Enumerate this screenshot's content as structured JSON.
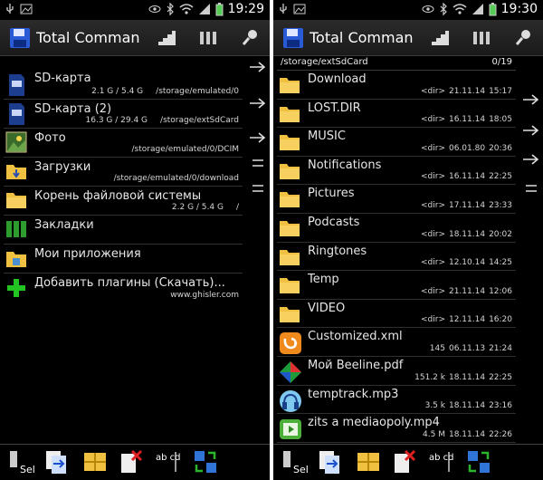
{
  "left": {
    "status": {
      "time": "19:29"
    },
    "app_title": "Total Comman...",
    "rows": [
      {
        "name": "SD-карта",
        "size": "2.1 G / 5.4 G",
        "path": "/storage/emulated/0",
        "icon": "sd-card-icon"
      },
      {
        "name": "SD-карта (2)",
        "size": "16.3 G / 29.4 G",
        "path": "/storage/extSdCard",
        "icon": "sd-card-icon"
      },
      {
        "name": "Фото",
        "size": "",
        "path": "/storage/emulated/0/DCIM",
        "icon": "photo-icon"
      },
      {
        "name": "Загрузки",
        "size": "",
        "path": "/storage/emulated/0/download",
        "icon": "downloads-folder-icon"
      },
      {
        "name": "Корень файловой системы",
        "size": "2.2 G / 5.4 G",
        "path": "/",
        "icon": "folder-icon"
      },
      {
        "name": "Закладки",
        "size": "",
        "path": "",
        "icon": "bookmarks-icon"
      },
      {
        "name": "Мои приложения",
        "size": "",
        "path": "",
        "icon": "apps-folder-icon"
      },
      {
        "name": "Добавить плагины (Скачать)...",
        "size": "",
        "path": "www.ghisler.com",
        "icon": "plus-icon"
      }
    ]
  },
  "right": {
    "status": {
      "time": "19:30"
    },
    "app_title": "Total Comman...",
    "path": "/storage/extSdCard",
    "count": "0/19",
    "rows": [
      {
        "name": "Download",
        "size": "<dir>",
        "date": "21.11.14",
        "time": "15:17",
        "icon": "folder-icon"
      },
      {
        "name": "LOST.DIR",
        "size": "<dir>",
        "date": "16.11.14",
        "time": "18:05",
        "icon": "folder-icon"
      },
      {
        "name": "MUSIC",
        "size": "<dir>",
        "date": "06.01.80",
        "time": "20:36",
        "icon": "folder-icon"
      },
      {
        "name": "Notifications",
        "size": "<dir>",
        "date": "16.11.14",
        "time": "22:25",
        "icon": "folder-icon"
      },
      {
        "name": "Pictures",
        "size": "<dir>",
        "date": "17.11.14",
        "time": "23:33",
        "icon": "folder-icon"
      },
      {
        "name": "Podcasts",
        "size": "<dir>",
        "date": "18.11.14",
        "time": "20:02",
        "icon": "folder-icon"
      },
      {
        "name": "Ringtones",
        "size": "<dir>",
        "date": "12.10.14",
        "time": "14:25",
        "icon": "folder-icon"
      },
      {
        "name": "Temp",
        "size": "<dir>",
        "date": "21.11.14",
        "time": "12:06",
        "icon": "folder-icon"
      },
      {
        "name": "VIDEO",
        "size": "<dir>",
        "date": "12.11.14",
        "time": "16:20",
        "icon": "folder-icon"
      },
      {
        "name": "Customized.xml",
        "size": "145",
        "date": "06.11.13",
        "time": "21:24",
        "icon": "uc-browser-icon"
      },
      {
        "name": "Мой Beeline.pdf",
        "size": "151.2 k",
        "date": "18.11.14",
        "time": "22:25",
        "icon": "office-doc-icon"
      },
      {
        "name": "temptrack.mp3",
        "size": "3.5 k",
        "date": "18.11.14",
        "time": "23:16",
        "icon": "headphones-icon"
      },
      {
        "name": "zits a mediaopoly.mp4",
        "size": "4.5 M",
        "date": "18.11.14",
        "time": "22:26",
        "icon": "video-player-icon"
      }
    ]
  },
  "toolbar": {
    "select_label": "Sel",
    "rename_label": "ab cd"
  },
  "colors": {
    "background": "#000000",
    "folder": "#f0c040",
    "divider": "#2e2e2e",
    "text": "#e6e6e6"
  }
}
